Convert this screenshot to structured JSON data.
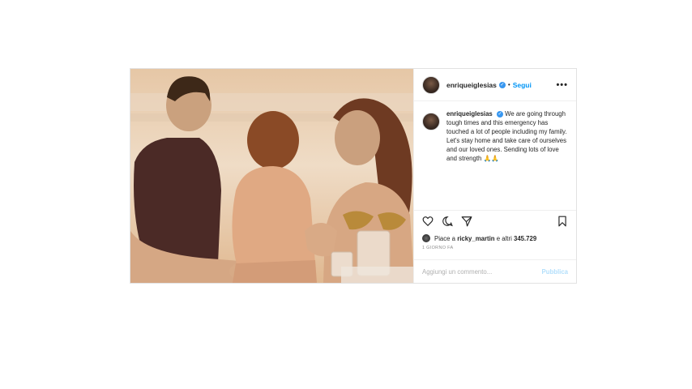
{
  "post": {
    "username": "enriqueiglesias",
    "follow_label": "Segui",
    "separator": "•",
    "more_label": "•••",
    "caption_text": "We are going through tough times and this emergency has touched a lot of people including my family. Let's stay home and take care of ourselves and our loved ones. Sending lots of love and strength 🙏🙏",
    "likes": {
      "prefix": "Piace a",
      "liker": "ricky_martin",
      "mid": "e altri",
      "count": "345.729"
    },
    "timestamp": "1 GIORNO FA",
    "comment_placeholder": "Aggiungi un commento...",
    "publish_label": "Pubblica"
  },
  "icons": {
    "like": "heart-icon",
    "comment": "comment-icon",
    "share": "share-icon",
    "save": "bookmark-icon"
  },
  "colors": {
    "accent": "#0095f6",
    "verified": "#3897f0",
    "muted": "#8e8e8e"
  }
}
